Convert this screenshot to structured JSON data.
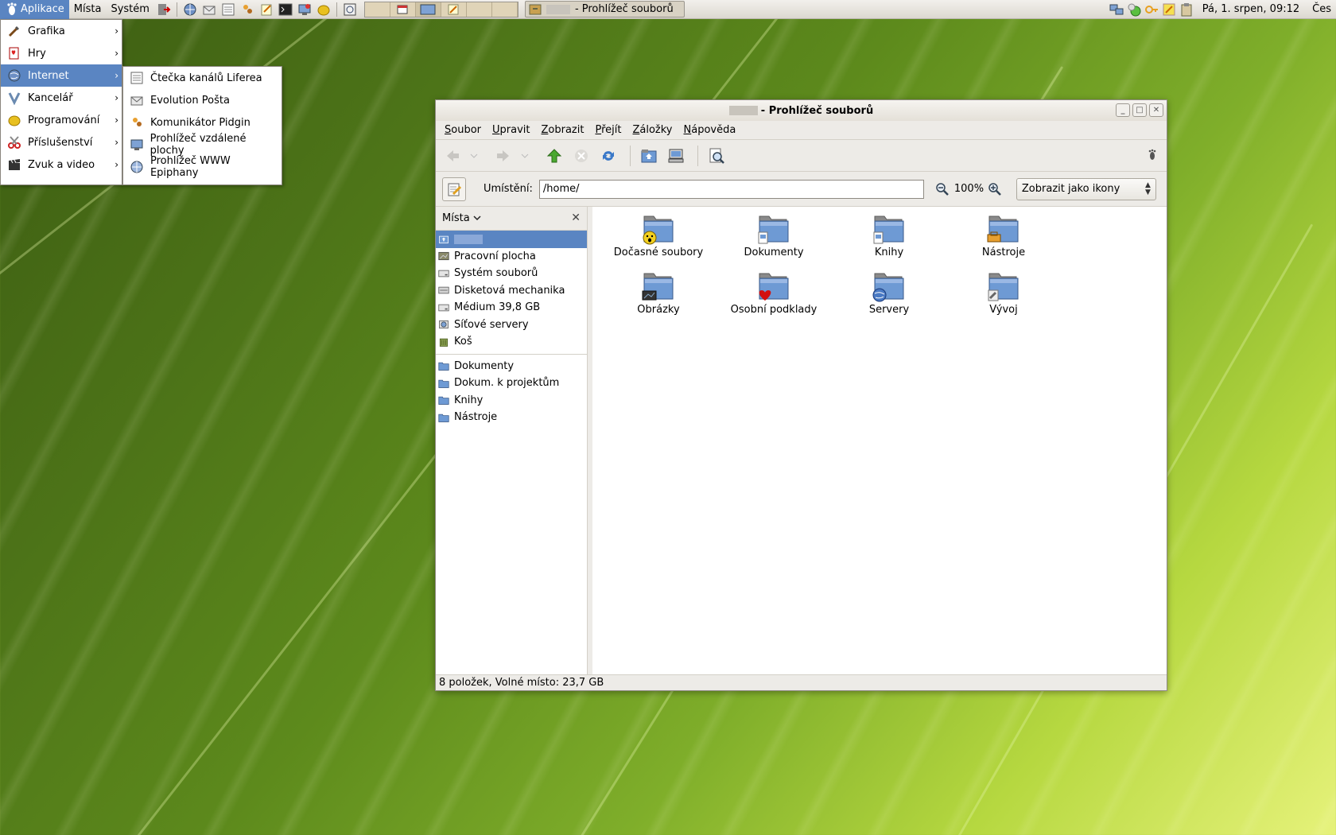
{
  "panel": {
    "menus": [
      "Aplikace",
      "Místa",
      "Systém"
    ],
    "task_title": "- Prohlížeč souborů",
    "clock": "Pá,  1. srpen, 09:12",
    "locale": "Čes",
    "launcher_icons": [
      "logout-icon",
      "browser-icon",
      "mail-icon",
      "feed-reader-icon",
      "pidgin-icon",
      "notes-icon",
      "terminal-icon",
      "remote-desktop-icon",
      "lemon-icon"
    ],
    "tray_icons": [
      "network-icon",
      "status-icon",
      "key-icon",
      "notes-icon",
      "clipboard-icon"
    ]
  },
  "app_menu": {
    "items": [
      {
        "label": "Grafika",
        "icon": "brush-icon"
      },
      {
        "label": "Hry",
        "icon": "cards-icon"
      },
      {
        "label": "Internet",
        "icon": "globe-icon",
        "selected": true
      },
      {
        "label": "Kancelář",
        "icon": "office-icon"
      },
      {
        "label": "Programování",
        "icon": "lemon-icon"
      },
      {
        "label": "Příslušenství",
        "icon": "scissors-icon"
      },
      {
        "label": "Zvuk a video",
        "icon": "clapper-icon"
      }
    ]
  },
  "internet_submenu": {
    "items": [
      {
        "label": "Čtečka kanálů Liferea",
        "icon": "feed-reader-icon"
      },
      {
        "label": "Evolution Pošta",
        "icon": "mail-icon"
      },
      {
        "label": "Komunikátor Pidgin",
        "icon": "pidgin-icon"
      },
      {
        "label": "Prohlížeč vzdálené plochy",
        "icon": "remote-desktop-icon"
      },
      {
        "label": "Prohlížeč WWW Epiphany",
        "icon": "browser-icon"
      }
    ]
  },
  "window": {
    "title": "- Prohlížeč souborů",
    "menubar": [
      {
        "label": "Soubor",
        "key": "S",
        "rest": "oubor"
      },
      {
        "label": "Upravit",
        "key": "U",
        "rest": "pravit"
      },
      {
        "label": "Zobrazit",
        "key": "Z",
        "rest": "obrazit"
      },
      {
        "label": "Přejít",
        "key": "P",
        "rest": "řejít"
      },
      {
        "label": "Záložky",
        "key": "Z",
        "rest": "áložky"
      },
      {
        "label": "Nápověda",
        "key": "N",
        "rest": "ápověda"
      }
    ],
    "location_label": "Umístění:",
    "location_value": "/home/",
    "zoom": "100%",
    "view_mode": "Zobrazit jako ikony",
    "sidebar_title": "Místa",
    "status": "8 položek, Volné místo: 23,7 GB"
  },
  "places": [
    {
      "label": "",
      "icon": "home-icon",
      "selected": true
    },
    {
      "label": "Pracovní plocha",
      "icon": "desktop-icon"
    },
    {
      "label": "Systém souborů",
      "icon": "drive-icon"
    },
    {
      "label": "Disketová mechanika",
      "icon": "floppy-icon"
    },
    {
      "label": "Médium 39,8 GB",
      "icon": "drive-icon"
    },
    {
      "label": "Síťové servery",
      "icon": "network-icon"
    },
    {
      "label": "Koš",
      "icon": "trash-icon"
    }
  ],
  "bookmarks": [
    {
      "label": "Dokumenty",
      "icon": "folder-icon"
    },
    {
      "label": "Dokum. k projektům",
      "icon": "folder-icon"
    },
    {
      "label": "Knihy",
      "icon": "folder-icon"
    },
    {
      "label": "Nástroje",
      "icon": "folder-icon"
    }
  ],
  "files": [
    {
      "label": "Dočasné soubory",
      "emblem": "face-icon"
    },
    {
      "label": "Dokumenty",
      "emblem": "document-icon"
    },
    {
      "label": "Knihy",
      "emblem": "document-icon"
    },
    {
      "label": "Nástroje",
      "emblem": "toolbox-icon"
    },
    {
      "label": "Obrázky",
      "emblem": "picture-icon"
    },
    {
      "label": "Osobní podklady",
      "emblem": "heart-icon"
    },
    {
      "label": "Servery",
      "emblem": "globe-icon"
    },
    {
      "label": "Vývoj",
      "emblem": "tools-icon"
    }
  ]
}
